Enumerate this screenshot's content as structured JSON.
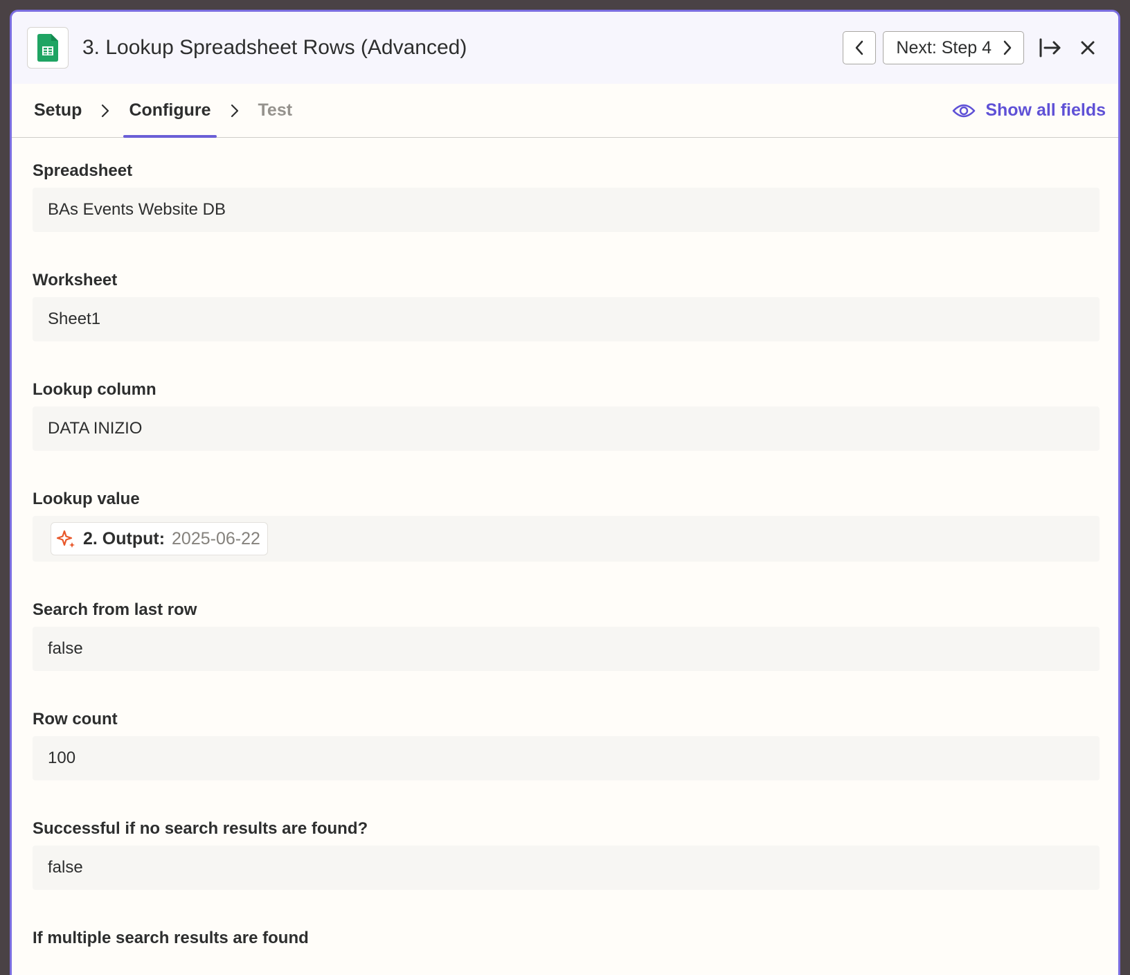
{
  "header": {
    "title": "3. Lookup Spreadsheet Rows (Advanced)",
    "next_label": "Next: Step 4"
  },
  "tabs": [
    {
      "label": "Setup"
    },
    {
      "label": "Configure"
    },
    {
      "label": "Test"
    }
  ],
  "show_all_label": "Show all fields",
  "fields": {
    "spreadsheet": {
      "label": "Spreadsheet",
      "value": "BAs Events Website DB"
    },
    "worksheet": {
      "label": "Worksheet",
      "value": "Sheet1"
    },
    "lookup_column": {
      "label": "Lookup column",
      "value": "DATA INIZIO"
    },
    "lookup_value": {
      "label": "Lookup value",
      "step": "2. Output:",
      "value": "2025-06-22"
    },
    "search_from_last_row": {
      "label": "Search from last row",
      "value": "false"
    },
    "row_count": {
      "label": "Row count",
      "value": "100"
    },
    "successful_if_none": {
      "label": "Successful if no search results are found?",
      "value": "false"
    },
    "multiple_results": {
      "label": "If multiple search results are found"
    }
  },
  "colors": {
    "accent": "#6b5fd6",
    "sheets_green": "#1fa463",
    "ai_orange": "#e8572a"
  }
}
